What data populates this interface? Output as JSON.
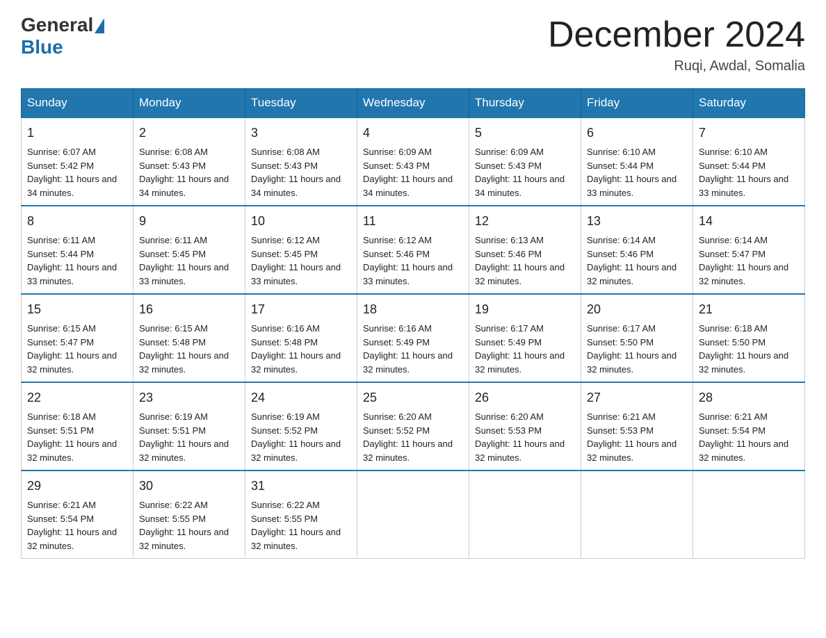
{
  "header": {
    "logo_general": "General",
    "logo_blue": "Blue",
    "title": "December 2024",
    "location": "Ruqi, Awdal, Somalia"
  },
  "days_of_week": [
    "Sunday",
    "Monday",
    "Tuesday",
    "Wednesday",
    "Thursday",
    "Friday",
    "Saturday"
  ],
  "weeks": [
    [
      {
        "day": "1",
        "sunrise": "6:07 AM",
        "sunset": "5:42 PM",
        "daylight": "11 hours and 34 minutes."
      },
      {
        "day": "2",
        "sunrise": "6:08 AM",
        "sunset": "5:43 PM",
        "daylight": "11 hours and 34 minutes."
      },
      {
        "day": "3",
        "sunrise": "6:08 AM",
        "sunset": "5:43 PM",
        "daylight": "11 hours and 34 minutes."
      },
      {
        "day": "4",
        "sunrise": "6:09 AM",
        "sunset": "5:43 PM",
        "daylight": "11 hours and 34 minutes."
      },
      {
        "day": "5",
        "sunrise": "6:09 AM",
        "sunset": "5:43 PM",
        "daylight": "11 hours and 34 minutes."
      },
      {
        "day": "6",
        "sunrise": "6:10 AM",
        "sunset": "5:44 PM",
        "daylight": "11 hours and 33 minutes."
      },
      {
        "day": "7",
        "sunrise": "6:10 AM",
        "sunset": "5:44 PM",
        "daylight": "11 hours and 33 minutes."
      }
    ],
    [
      {
        "day": "8",
        "sunrise": "6:11 AM",
        "sunset": "5:44 PM",
        "daylight": "11 hours and 33 minutes."
      },
      {
        "day": "9",
        "sunrise": "6:11 AM",
        "sunset": "5:45 PM",
        "daylight": "11 hours and 33 minutes."
      },
      {
        "day": "10",
        "sunrise": "6:12 AM",
        "sunset": "5:45 PM",
        "daylight": "11 hours and 33 minutes."
      },
      {
        "day": "11",
        "sunrise": "6:12 AM",
        "sunset": "5:46 PM",
        "daylight": "11 hours and 33 minutes."
      },
      {
        "day": "12",
        "sunrise": "6:13 AM",
        "sunset": "5:46 PM",
        "daylight": "11 hours and 32 minutes."
      },
      {
        "day": "13",
        "sunrise": "6:14 AM",
        "sunset": "5:46 PM",
        "daylight": "11 hours and 32 minutes."
      },
      {
        "day": "14",
        "sunrise": "6:14 AM",
        "sunset": "5:47 PM",
        "daylight": "11 hours and 32 minutes."
      }
    ],
    [
      {
        "day": "15",
        "sunrise": "6:15 AM",
        "sunset": "5:47 PM",
        "daylight": "11 hours and 32 minutes."
      },
      {
        "day": "16",
        "sunrise": "6:15 AM",
        "sunset": "5:48 PM",
        "daylight": "11 hours and 32 minutes."
      },
      {
        "day": "17",
        "sunrise": "6:16 AM",
        "sunset": "5:48 PM",
        "daylight": "11 hours and 32 minutes."
      },
      {
        "day": "18",
        "sunrise": "6:16 AM",
        "sunset": "5:49 PM",
        "daylight": "11 hours and 32 minutes."
      },
      {
        "day": "19",
        "sunrise": "6:17 AM",
        "sunset": "5:49 PM",
        "daylight": "11 hours and 32 minutes."
      },
      {
        "day": "20",
        "sunrise": "6:17 AM",
        "sunset": "5:50 PM",
        "daylight": "11 hours and 32 minutes."
      },
      {
        "day": "21",
        "sunrise": "6:18 AM",
        "sunset": "5:50 PM",
        "daylight": "11 hours and 32 minutes."
      }
    ],
    [
      {
        "day": "22",
        "sunrise": "6:18 AM",
        "sunset": "5:51 PM",
        "daylight": "11 hours and 32 minutes."
      },
      {
        "day": "23",
        "sunrise": "6:19 AM",
        "sunset": "5:51 PM",
        "daylight": "11 hours and 32 minutes."
      },
      {
        "day": "24",
        "sunrise": "6:19 AM",
        "sunset": "5:52 PM",
        "daylight": "11 hours and 32 minutes."
      },
      {
        "day": "25",
        "sunrise": "6:20 AM",
        "sunset": "5:52 PM",
        "daylight": "11 hours and 32 minutes."
      },
      {
        "day": "26",
        "sunrise": "6:20 AM",
        "sunset": "5:53 PM",
        "daylight": "11 hours and 32 minutes."
      },
      {
        "day": "27",
        "sunrise": "6:21 AM",
        "sunset": "5:53 PM",
        "daylight": "11 hours and 32 minutes."
      },
      {
        "day": "28",
        "sunrise": "6:21 AM",
        "sunset": "5:54 PM",
        "daylight": "11 hours and 32 minutes."
      }
    ],
    [
      {
        "day": "29",
        "sunrise": "6:21 AM",
        "sunset": "5:54 PM",
        "daylight": "11 hours and 32 minutes."
      },
      {
        "day": "30",
        "sunrise": "6:22 AM",
        "sunset": "5:55 PM",
        "daylight": "11 hours and 32 minutes."
      },
      {
        "day": "31",
        "sunrise": "6:22 AM",
        "sunset": "5:55 PM",
        "daylight": "11 hours and 32 minutes."
      },
      null,
      null,
      null,
      null
    ]
  ]
}
